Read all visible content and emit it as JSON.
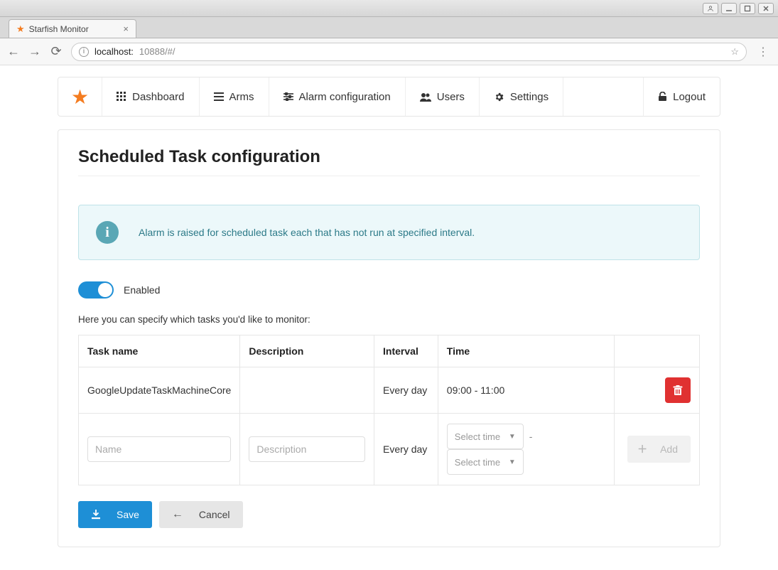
{
  "os": {
    "user_icon": "user"
  },
  "browser": {
    "tab_title": "Starfish Monitor",
    "url_host": "localhost:",
    "url_rest": "10888/#/"
  },
  "nav": {
    "dashboard": "Dashboard",
    "arms": "Arms",
    "alarm_config": "Alarm configuration",
    "users": "Users",
    "settings": "Settings",
    "logout": "Logout"
  },
  "page": {
    "title": "Scheduled Task configuration",
    "callout": "Alarm is raised for scheduled task each that has not run at specified interval.",
    "toggle_label": "Enabled",
    "help": "Here you can specify which tasks you'd like to monitor:"
  },
  "table": {
    "headers": {
      "task": "Task name",
      "desc": "Description",
      "interval": "Interval",
      "time": "Time"
    },
    "rows": [
      {
        "task": "GoogleUpdateTaskMachineCore",
        "desc": "",
        "interval": "Every day",
        "time": "09:00 - 11:00"
      }
    ],
    "new_row": {
      "name_placeholder": "Name",
      "desc_placeholder": "Description",
      "interval": "Every day",
      "time_placeholder": "Select time",
      "add_label": "Add"
    }
  },
  "buttons": {
    "save": "Save",
    "cancel": "Cancel"
  }
}
